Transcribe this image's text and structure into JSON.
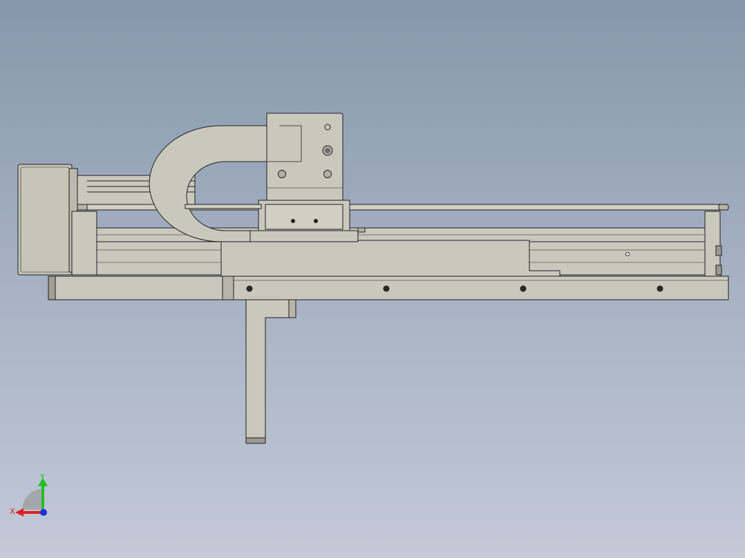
{
  "view": {
    "background_top": "#8797ab",
    "background_bottom": "#c3c9d7",
    "part_fill": "#c8c8bc",
    "part_fill_dark": "#a9a99e",
    "edge_color": "#1e1e1e"
  },
  "triad": {
    "x_label": "X",
    "y_label": "Y",
    "x_color": "#e02020",
    "y_color": "#20c020",
    "z_color": "#2030e0"
  }
}
